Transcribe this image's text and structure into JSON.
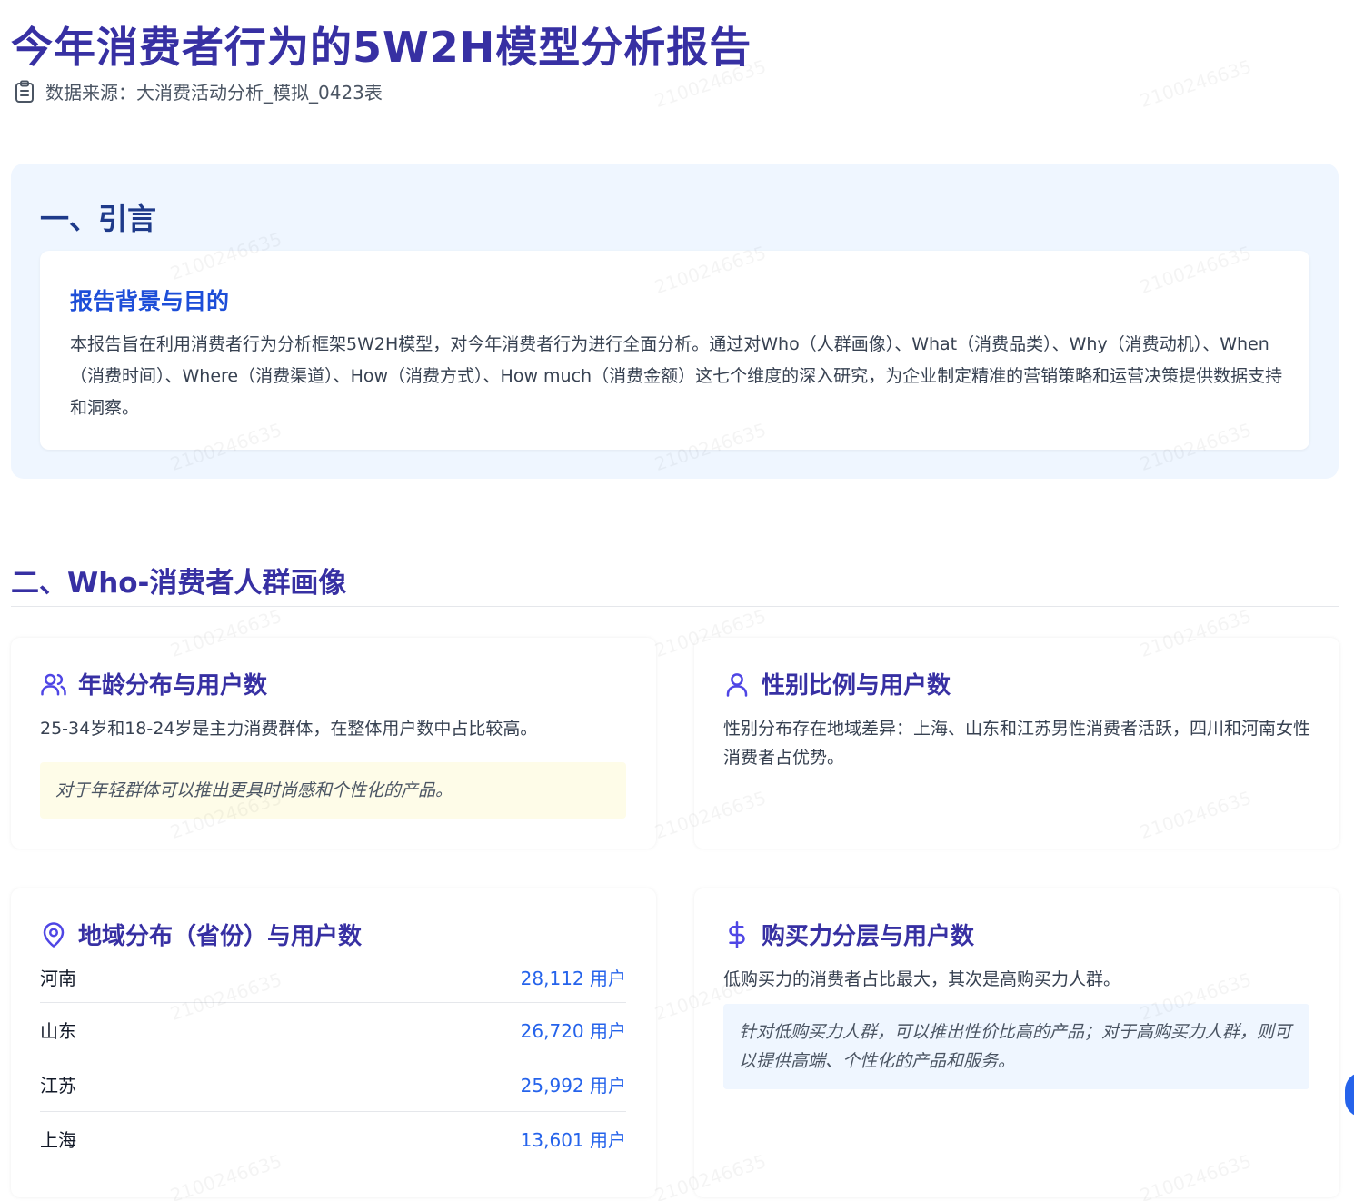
{
  "report": {
    "title": "今年消费者行为的5W2H模型分析报告",
    "source": "数据来源：大消费活动分析_模拟_0423表"
  },
  "intro": {
    "heading": "一、引言",
    "card_title": "报告背景与目的",
    "card_text": "本报告旨在利用消费者行为分析框架5W2H模型，对今年消费者行为进行全面分析。通过对Who（人群画像）、What（消费品类）、Why（消费动机）、When（消费时间）、Where（消费渠道）、How（消费方式）、How much（消费金额）这七个维度的深入研究，为企业制定精准的营销策略和运营决策提供数据支持和洞察。"
  },
  "who": {
    "heading": "二、Who-消费者人群画像",
    "age": {
      "title": "年龄分布与用户数",
      "text": "25-34岁和18-24岁是主力消费群体，在整体用户数中占比较高。",
      "note": "对于年轻群体可以推出更具时尚感和个性化的产品。"
    },
    "gender": {
      "title": "性别比例与用户数",
      "text": "性别分布存在地域差异：上海、山东和江苏男性消费者活跃，四川和河南女性消费者占优势。"
    },
    "region": {
      "title": "地域分布（省份）与用户数",
      "rows": [
        {
          "name": "河南",
          "value": "28,112 用户"
        },
        {
          "name": "山东",
          "value": "26,720 用户"
        },
        {
          "name": "江苏",
          "value": "25,992 用户"
        },
        {
          "name": "上海",
          "value": "13,601 用户"
        }
      ]
    },
    "purchase": {
      "title": "购买力分层与用户数",
      "text": "低购买力的消费者占比最大，其次是高购买力人群。",
      "note": "针对低购买力人群，可以推出性价比高的产品；对于高购买力人群，则可以提供高端、个性化的产品和服务。"
    }
  },
  "watermark": "2100246635",
  "icons": {
    "source": "clipboard-icon",
    "age": "users-icon",
    "gender": "user-icon",
    "region": "map-pin-icon",
    "purchase": "dollar-icon"
  },
  "colors": {
    "title": "#3730a3",
    "accent": "#2563eb",
    "intro_bg": "#eff6ff",
    "note_yellow": "#fefce8"
  }
}
